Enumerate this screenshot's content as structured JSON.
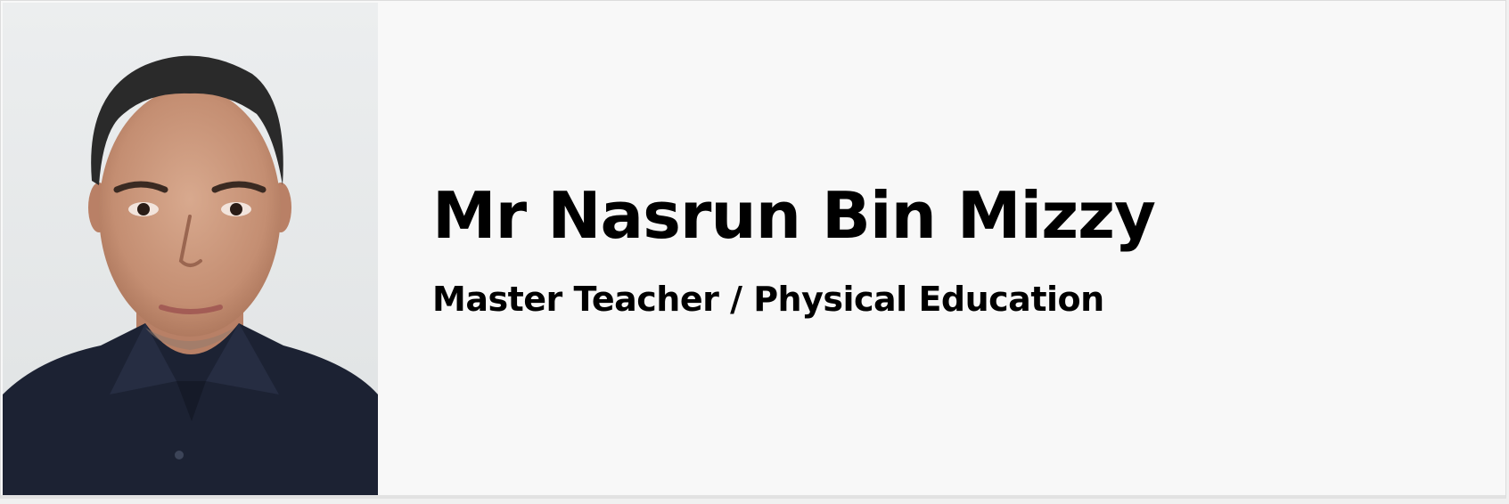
{
  "profile": {
    "photo_icon": "person-portrait",
    "name": "Mr Nasrun Bin Mizzy",
    "title": "Master Teacher / Physical Education"
  },
  "colors": {
    "card_background": "#f8f8f8",
    "photo_background": "#e6e7e8",
    "shirt": "#1c2233",
    "text": "#000000"
  }
}
